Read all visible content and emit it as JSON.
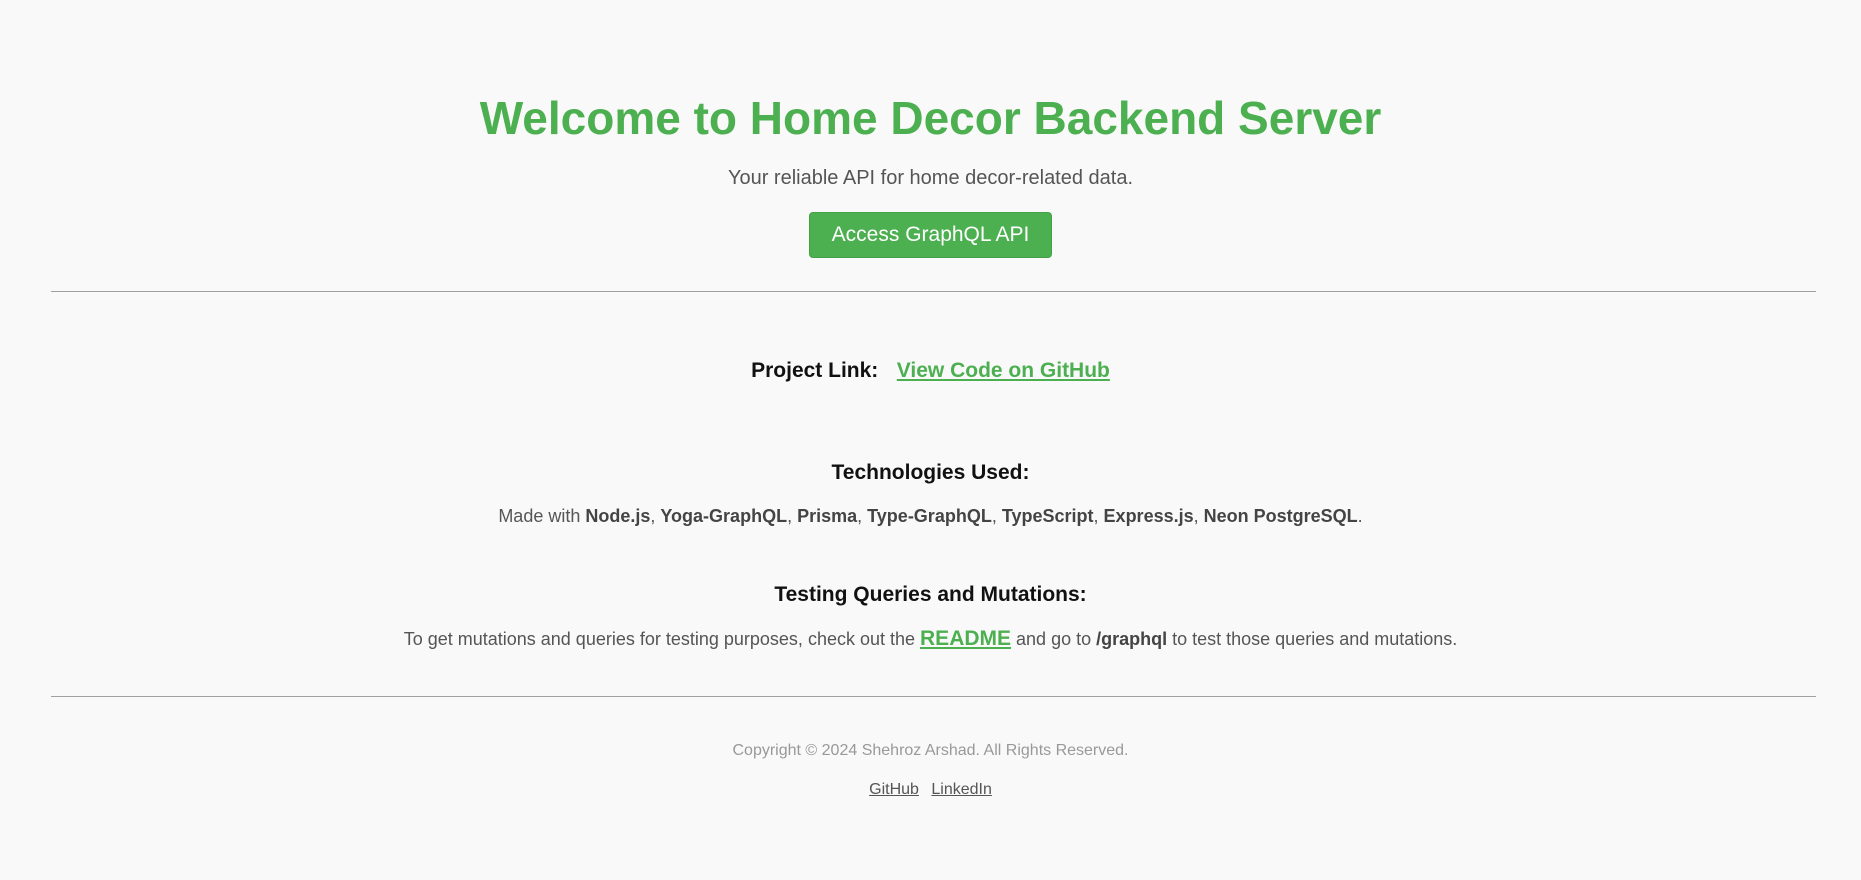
{
  "hero": {
    "title": "Welcome to Home Decor Backend Server",
    "subtitle": "Your reliable API for home decor-related data.",
    "cta_label": "Access GraphQL API"
  },
  "project": {
    "label": "Project Link:",
    "link_text": "View Code on GitHub"
  },
  "technologies": {
    "heading": "Technologies Used:",
    "prefix": "Made with ",
    "items": [
      "Node.js",
      "Yoga-GraphQL",
      "Prisma",
      "Type-GraphQL",
      "TypeScript",
      "Express.js",
      "Neon PostgreSQL"
    ],
    "separator": ", ",
    "suffix": "."
  },
  "testing": {
    "heading": "Testing Queries and Mutations:",
    "text_before": "To get mutations and queries for testing purposes, check out the ",
    "readme_link": "README",
    "text_middle": " and go to ",
    "route": "/graphql",
    "text_after": " to test those queries and mutations."
  },
  "footer": {
    "copyright": "Copyright © 2024 Shehroz Arshad. All Rights Reserved.",
    "links": [
      "GitHub",
      "LinkedIn"
    ]
  },
  "colors": {
    "accent": "#4caf50",
    "background": "#f9f9f9",
    "text": "#555555",
    "heading": "#111111",
    "muted": "#999999"
  }
}
